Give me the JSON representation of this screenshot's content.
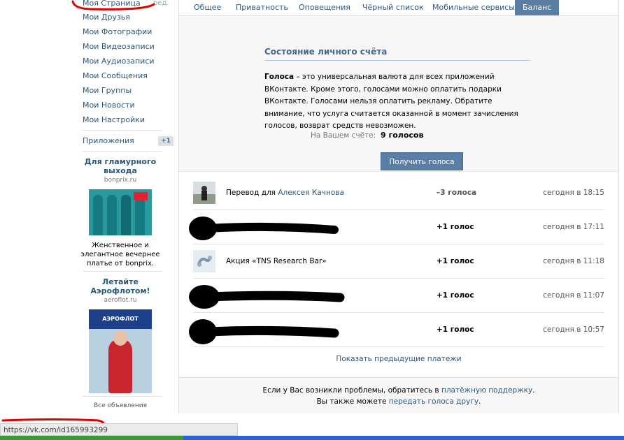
{
  "sidebar": {
    "items": [
      {
        "label": "Моя Страница"
      },
      {
        "label": "Мои Друзья"
      },
      {
        "label": "Мои Фотографии"
      },
      {
        "label": "Мои Видеозаписи"
      },
      {
        "label": "Мои Аудиозаписи"
      },
      {
        "label": "Мои Сообщения"
      },
      {
        "label": "Мои Группы"
      },
      {
        "label": "Мои Новости"
      },
      {
        "label": "Мои Настройки"
      }
    ],
    "edit_label": "ред.",
    "apps_label": "Приложения",
    "apps_badge": "+1",
    "ads": [
      {
        "title": "Для гламурного выхода",
        "domain": "bonprix.ru",
        "text": "Женственное и элегантное вечернее платье от bonprix."
      },
      {
        "title": "Летайте Аэрофлотом!",
        "domain": "aeroflot.ru",
        "image_text": "АЭРОФЛОТ"
      }
    ],
    "all_ads_label": "Все объявления"
  },
  "tabs": [
    {
      "label": "Общее",
      "active": false
    },
    {
      "label": "Приватность",
      "active": false
    },
    {
      "label": "Оповещения",
      "active": false
    },
    {
      "label": "Чёрный список",
      "active": false
    },
    {
      "label": "Мобильные сервисы",
      "active": false
    },
    {
      "label": "Баланс",
      "active": true
    }
  ],
  "balance": {
    "title": "Состояние личного счёта",
    "desc_bold": "Голоса",
    "desc_rest": " – это универсальная валюта для всех приложений ВКонтакте. Кроме этого, голосами можно оплатить подарки ВКонтакте. Голосами нельзя оплатить рекламу. Обратите внимание, что услуга считается оказанной в момент зачисления голосов, возврат средств невозможен.",
    "account_label": "На Вашем счёте:",
    "account_value": "9 голосов",
    "get_votes_button": "Получить голоса"
  },
  "payments": [
    {
      "prefix": "Перевод для ",
      "link": "Алексея Качнова",
      "amount": "–3 голоса",
      "time": "сегодня в 18:15",
      "redacted": false
    },
    {
      "prefix": "",
      "link": "",
      "amount": "+1 голос",
      "time": "сегодня в 17:11",
      "redacted": true
    },
    {
      "prefix": "Акция «TNS Research Bar»",
      "link": "",
      "amount": "+1 голос",
      "time": "сегодня в 11:18",
      "redacted": false
    },
    {
      "prefix": "",
      "link": "",
      "amount": "+1 голос",
      "time": "сегодня в 11:07",
      "redacted": true
    },
    {
      "prefix": "",
      "link": "",
      "amount": "+1 голос",
      "time": "сегодня в 10:57",
      "redacted": true
    }
  ],
  "show_previous": "Показать предыдущие платежи",
  "footer": {
    "line1_text": "Если у Вас возникли проблемы, обратитесь в ",
    "line1_link": "платёжную поддержку",
    "line1_end": ".",
    "line2_text": "Вы также можете ",
    "line2_link": "передать голоса другу",
    "line2_end": "."
  },
  "status_bar": "https://vk.com/id165993299",
  "colors": {
    "accent": "#597da3",
    "link": "#2b587a",
    "marker": "#e00000"
  }
}
